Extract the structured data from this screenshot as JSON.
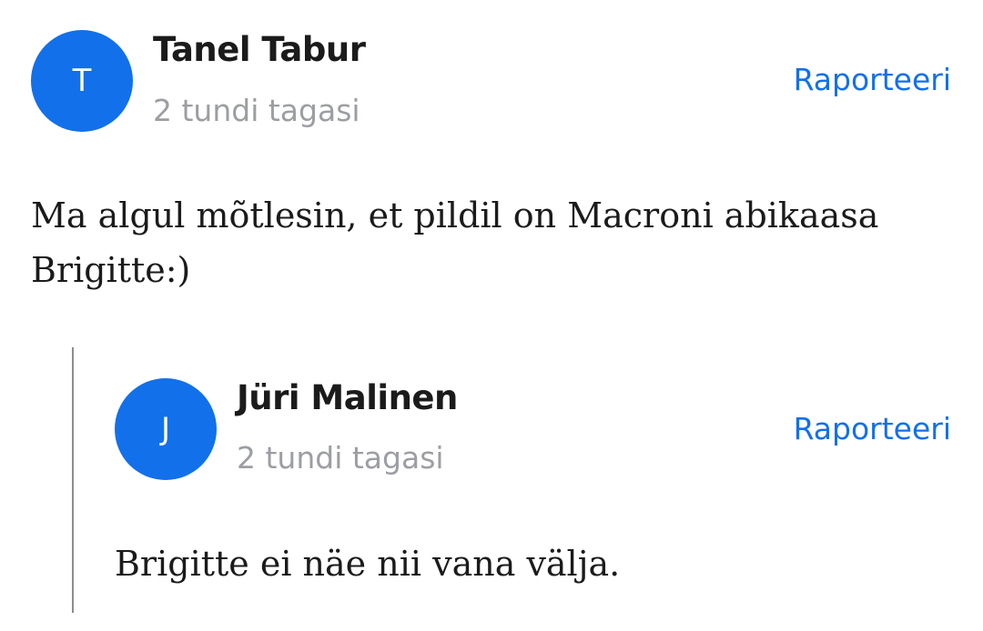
{
  "comments": [
    {
      "avatar_initial": "T",
      "author": "Tanel Tabur",
      "time": "2 tundi tagasi",
      "report_label": "Raporteeri",
      "text": "Ma algul mõtlesin, et pildil on Macroni abikaasa Brigitte:)"
    }
  ],
  "replies": [
    {
      "avatar_initial": "J",
      "author": "Jüri Malinen",
      "time": "2 tundi tagasi",
      "report_label": "Raporteeri",
      "text": "Brigitte ei näe nii vana välja."
    }
  ],
  "colors": {
    "accent": "#1270eb",
    "author_text": "#1b1b1b",
    "muted_text": "#9c9ea3",
    "thread_line": "#8d8d8d"
  }
}
